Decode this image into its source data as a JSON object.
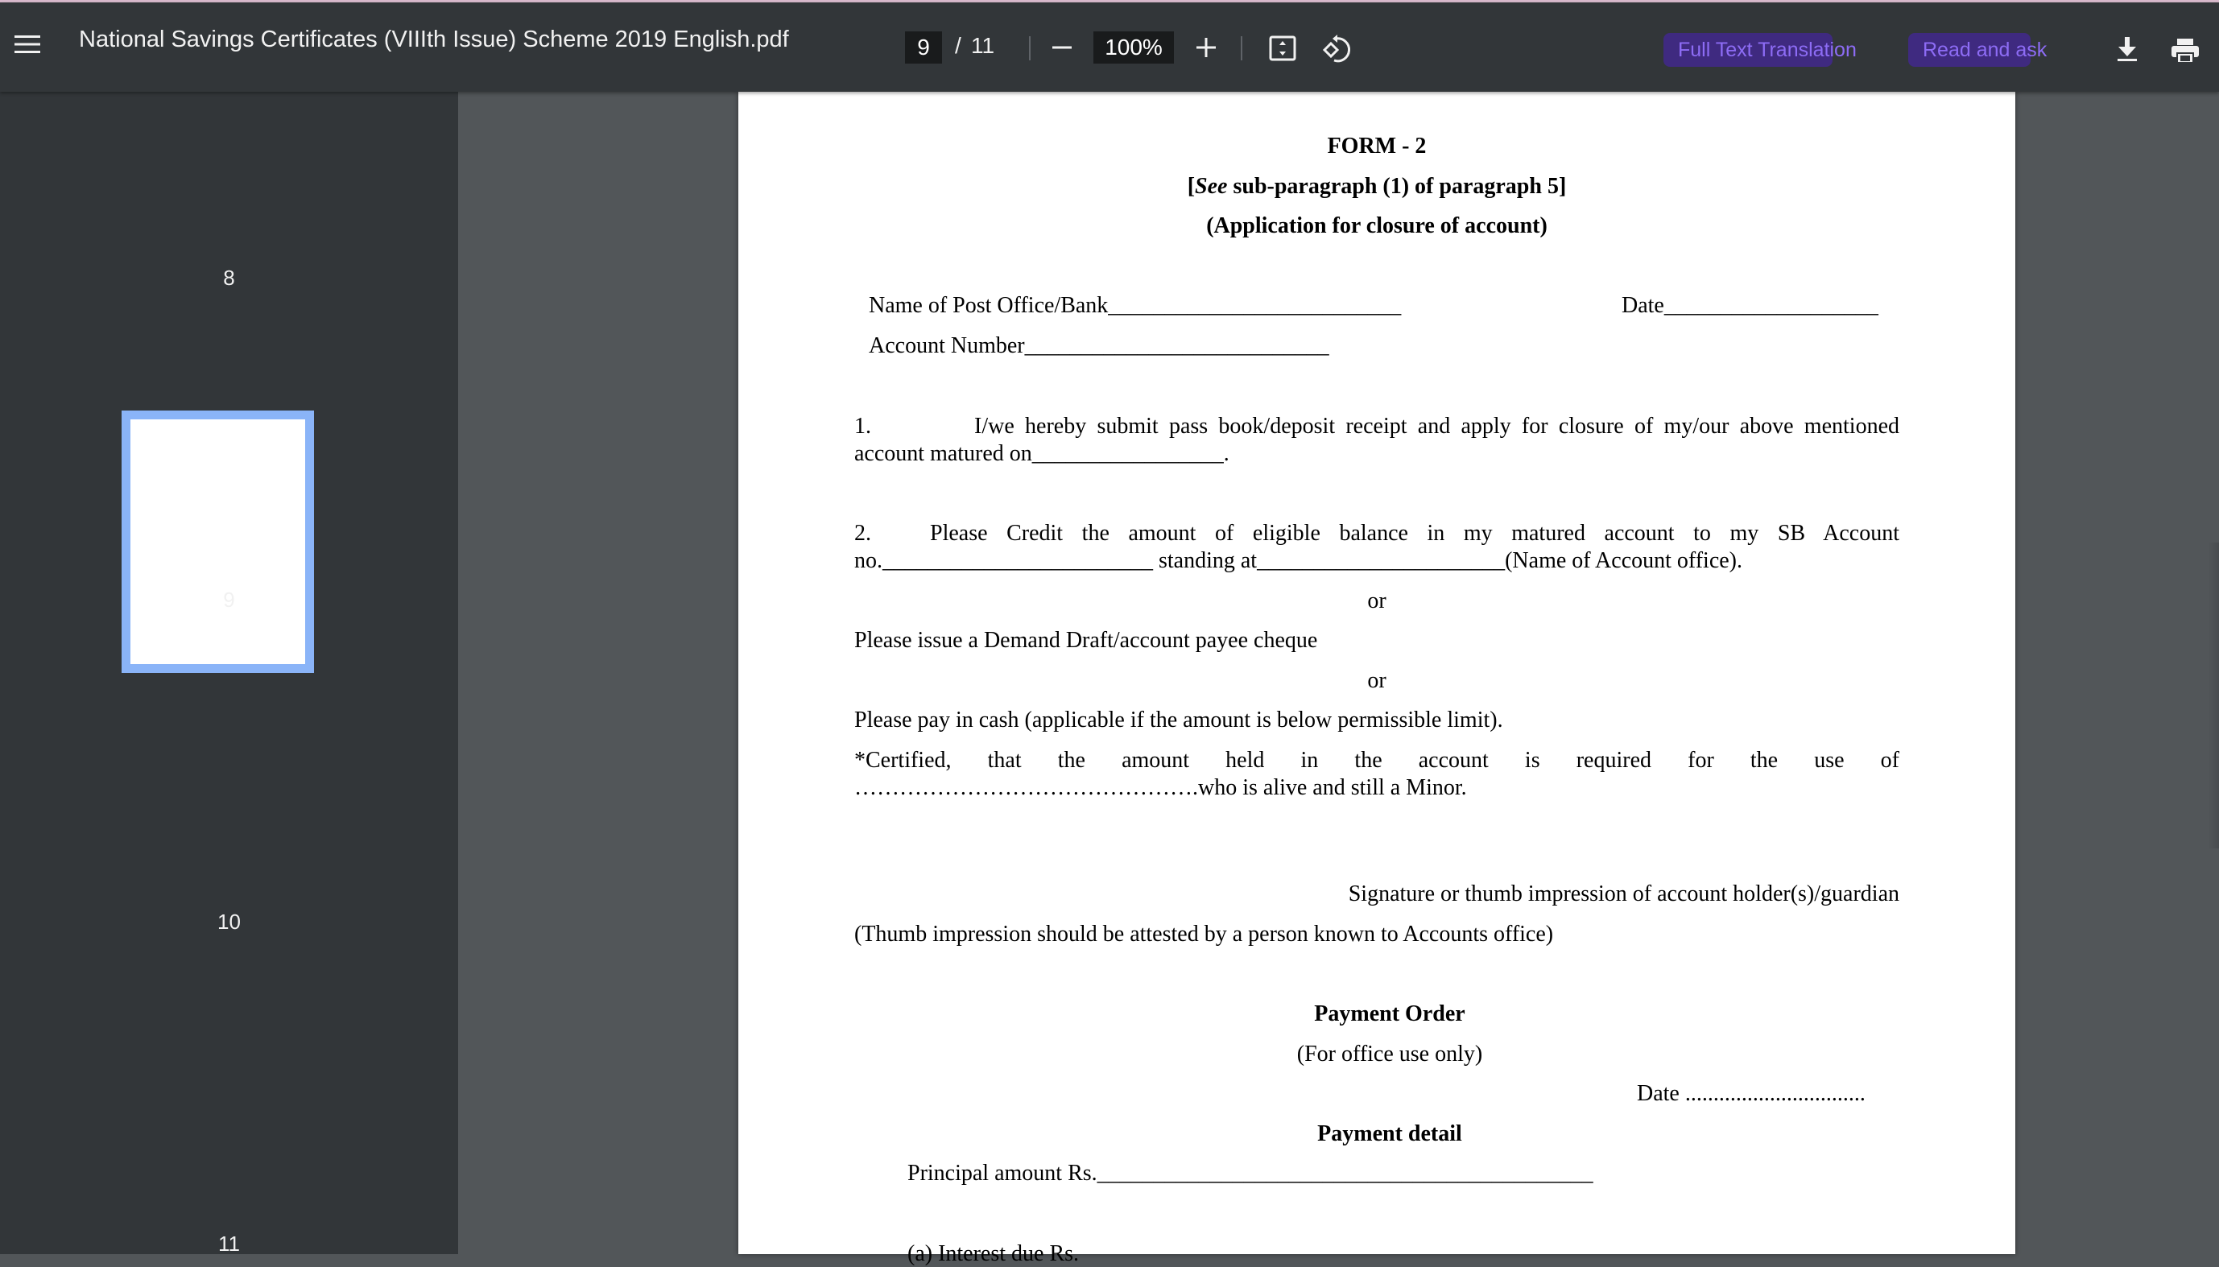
{
  "toolbar": {
    "title": "National Savings Certificates (VIIIth Issue) Scheme 2019 English.pdf",
    "current_page": "9",
    "page_separator": "/",
    "total_pages": "11",
    "zoom_level": "100%",
    "translate_label": "Full Text Translation",
    "ask_label": "Read and ask",
    "icons": {
      "menu": "hamburger-menu-icon",
      "zoom_out": "minus-icon",
      "zoom_in": "plus-icon",
      "fit": "fit-to-page-icon",
      "rotate": "rotate-counterclockwise-icon",
      "translate": "translate-icon",
      "ask": "sparkle-icon",
      "download": "download-icon",
      "print": "print-icon"
    },
    "colors": {
      "toolbar_bg": "#323639",
      "pill_bg": "#3f2a80",
      "pill_text": "#8d6cf5"
    }
  },
  "sidebar": {
    "thumbnails": [
      {
        "label": "8"
      },
      {
        "label": "9",
        "selected": true
      },
      {
        "label": "10"
      },
      {
        "label": "11"
      }
    ],
    "selected_color": "#8ab4f8"
  },
  "document": {
    "form_title": "FORM - 2",
    "ref_italic": "See",
    "ref_open": "[",
    "ref_rest": " sub-paragraph (1) of paragraph 5]",
    "subtitle": "(Application for closure of account)",
    "post_office_field": "Name of Post Office/Bank__________________________",
    "date_field": "Date___________________",
    "account_number_field": "Account Number___________________________",
    "item1_num": "1.",
    "item1_line1": "I/we hereby submit pass book/deposit receipt and apply for closure of my/our above mentioned",
    "item1_line2": "account matured on_________________.",
    "item2_num": "2.",
    "item2_line1": "Please Credit the amount of eligible balance in my matured account to my SB Account",
    "item2_line2": "no.________________________ standing at______________________(Name of Account office).",
    "or1": "or",
    "demand_draft": "Please issue a Demand Draft/account payee cheque",
    "or2": "or",
    "cash": "Please pay in cash (applicable if the amount is below permissible limit).",
    "certified_line1": "*Certified, that the amount held in the account is required for the use of",
    "certified_line2": "……………………………………….who is alive and still a Minor.",
    "signature": "Signature or thumb impression of account holder(s)/guardian",
    "thumb_note": "(Thumb impression should be attested by a person known to Accounts office)",
    "payment_order": "Payment Order",
    "office_use": "(For office use only)",
    "po_date": "Date ................................",
    "payment_detail": "Payment detail",
    "principal": "Principal amount Rs.____________________________________________",
    "interest_partial": "(a) Interest due Rs."
  }
}
